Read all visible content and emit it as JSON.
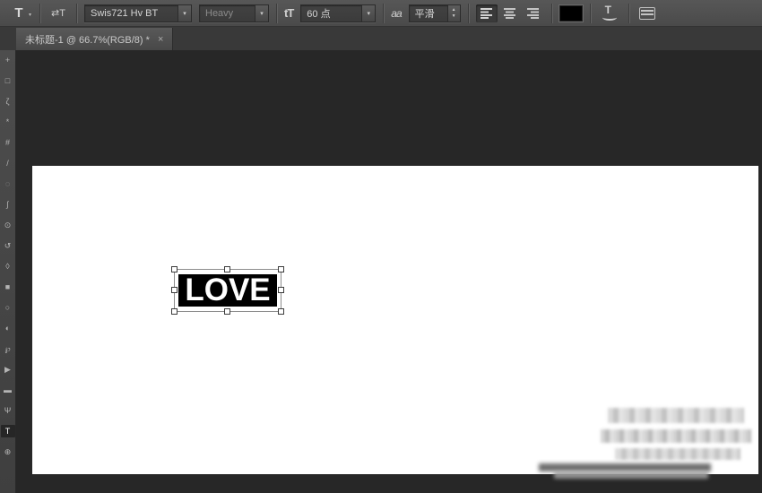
{
  "options_bar": {
    "tool_letter": "T",
    "font_family": "Swis721 Hv BT",
    "font_style": "Heavy",
    "font_size": "60 点",
    "anti_alias": "平滑",
    "text_color": "#000000"
  },
  "icons": {
    "dropdown_arrow": "▾",
    "mini_arrow": "▾",
    "spinner_up": "▲",
    "spinner_down": "▼",
    "orientation_icon_text": "⇄T",
    "size_icon_text": "tT",
    "anti_alias_icon_text": "aa",
    "warp_letter": "T"
  },
  "tab": {
    "title": "未标题-1 @ 66.7%(RGB/8) *",
    "close_label": "×"
  },
  "toolbar": {
    "items": [
      {
        "name": "move-tool",
        "glyph": "+"
      },
      {
        "name": "marquee-tool",
        "glyph": "□"
      },
      {
        "name": "lasso-tool",
        "glyph": "ζ"
      },
      {
        "name": "quick-select-tool",
        "glyph": "*"
      },
      {
        "name": "crop-tool",
        "glyph": "#"
      },
      {
        "name": "eyedropper-tool",
        "glyph": "/"
      },
      {
        "name": "healing-brush-tool",
        "glyph": "◌"
      },
      {
        "name": "brush-tool",
        "glyph": "∫"
      },
      {
        "name": "clone-stamp-tool",
        "glyph": "⊙"
      },
      {
        "name": "history-brush-tool",
        "glyph": "↺"
      },
      {
        "name": "eraser-tool",
        "glyph": "◊"
      },
      {
        "name": "gradient-tool",
        "glyph": "■"
      },
      {
        "name": "blur-tool",
        "glyph": "○"
      },
      {
        "name": "dodge-tool",
        "glyph": "◐"
      },
      {
        "name": "pen-tool",
        "glyph": "℘"
      },
      {
        "name": "path-select-tool",
        "glyph": "▶"
      },
      {
        "name": "shape-tool",
        "glyph": "▬"
      },
      {
        "name": "hand-tool",
        "glyph": "Ψ"
      },
      {
        "name": "type-tool",
        "glyph": "T",
        "active": true
      },
      {
        "name": "zoom-tool",
        "glyph": "⊕"
      }
    ]
  },
  "canvas": {
    "text": "LOVE",
    "zoom_level": "66.7%"
  }
}
